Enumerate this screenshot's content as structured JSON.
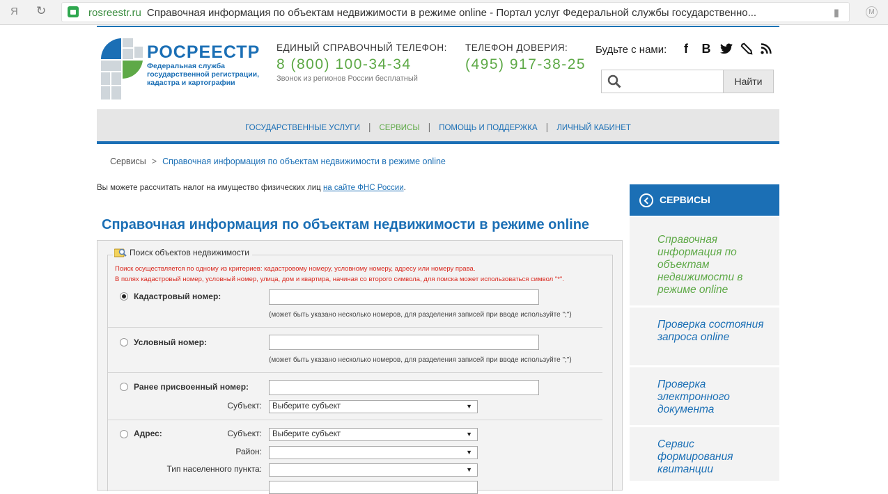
{
  "browser": {
    "ya_label": "Я",
    "domain": "rosreestr.ru",
    "page_title": "Справочная информация по объектам недвижимости в режиме online - Портал услуг Федеральной службы государственно..."
  },
  "header": {
    "logo_name": "РОСРЕЕСТР",
    "logo_subtitle": "Федеральная служба государственной регистрации, кадастра и картографии",
    "phone1_label": "ЕДИНЫЙ СПРАВОЧНЫЙ ТЕЛЕФОН:",
    "phone1": "8 (800) 100-34-34",
    "phone1_note": "Звонок из регионов России бесплатный",
    "phone2_label": "ТЕЛЕФОН ДОВЕРИЯ:",
    "phone2": "(495) 917-38-25",
    "social_label": "Будьте с нами:",
    "social": [
      "f",
      "B"
    ],
    "search_placeholder": "",
    "search_button": "Найти"
  },
  "nav": {
    "items": [
      {
        "label": "ГОСУДАРСТВЕННЫЕ УСЛУГИ"
      },
      {
        "label": "СЕРВИСЫ"
      },
      {
        "label": "ПОМОЩЬ И ПОДДЕРЖКА"
      },
      {
        "label": "ЛИЧНЫЙ КАБИНЕТ"
      }
    ],
    "separator": "|"
  },
  "breadcrumb": {
    "root": "Сервисы",
    "separator": ">",
    "current": "Справочная информация по объектам недвижимости в режиме online"
  },
  "tax_note": {
    "text": "Вы можете рассчитать налог на имущество физических лиц",
    "link": "на сайте ФНС России",
    "end": "."
  },
  "page_title": "Справочная информация по объектам недвижимости в режиме online",
  "form": {
    "legend": "Поиск объектов недвижимости",
    "hint1": "Поиск осуществляется по одному из критериев: кадастровому номеру, условному номеру, адресу или номеру права.",
    "hint2": "В полях кадастровый номер, условный номер, улица, дом и квартира, начиная со второго символа, для поиска может использоваться символ \"*\".",
    "cadastral_label": "Кадастровый номер:",
    "cadastral_note": "(может быть указано несколько номеров, для разделения записей при вводе используйте \";\")",
    "conditional_label": "Условный номер:",
    "conditional_note": "(может быть указано несколько номеров, для разделения записей при вводе используйте \";\")",
    "previous_label": "Ранее присвоенный номер:",
    "subject_label": "Субъект:",
    "subject_placeholder": "Выберите субъект",
    "address_label": "Адрес:",
    "district_label": "Район:",
    "settlement_type_label": "Тип населенного пункта:"
  },
  "sidebar": {
    "title": "СЕРВИСЫ",
    "items": [
      {
        "label": "Справочная информация по объектам недвижимости в режиме online"
      },
      {
        "label": "Проверка состояния запроса online"
      },
      {
        "label": "Проверка электронного документа"
      },
      {
        "label": "Сервис формирования квитанции"
      }
    ]
  },
  "colors": {
    "brand_blue": "#1b6fb5",
    "brand_green": "#5ea947",
    "hint_red": "#d9261c"
  }
}
